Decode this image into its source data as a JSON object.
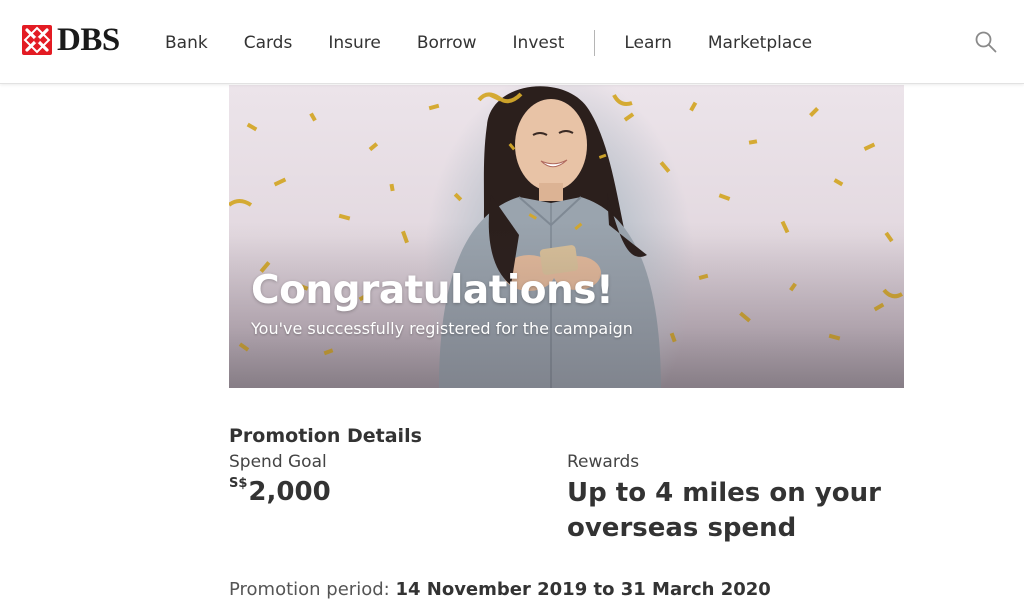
{
  "brand": {
    "name": "DBS",
    "accent": "#e31b23"
  },
  "nav": {
    "items": [
      {
        "label": "Bank"
      },
      {
        "label": "Cards"
      },
      {
        "label": "Insure"
      },
      {
        "label": "Borrow"
      },
      {
        "label": "Invest"
      },
      {
        "label": "Learn"
      },
      {
        "label": "Marketplace"
      }
    ],
    "search_icon": "search-icon"
  },
  "hero": {
    "title": "Congratulations!",
    "subtitle": "You've successfully registered for the campaign",
    "confetti_color": "#d4a82a"
  },
  "promotion": {
    "heading": "Promotion Details",
    "spend_goal": {
      "label": "Spend Goal",
      "currency": "S$",
      "amount": "2,000"
    },
    "rewards": {
      "label": "Rewards",
      "value": "Up to 4 miles on your overseas spend"
    },
    "period": {
      "label": "Promotion period:",
      "value": "14 November 2019 to 31 March 2020"
    }
  }
}
